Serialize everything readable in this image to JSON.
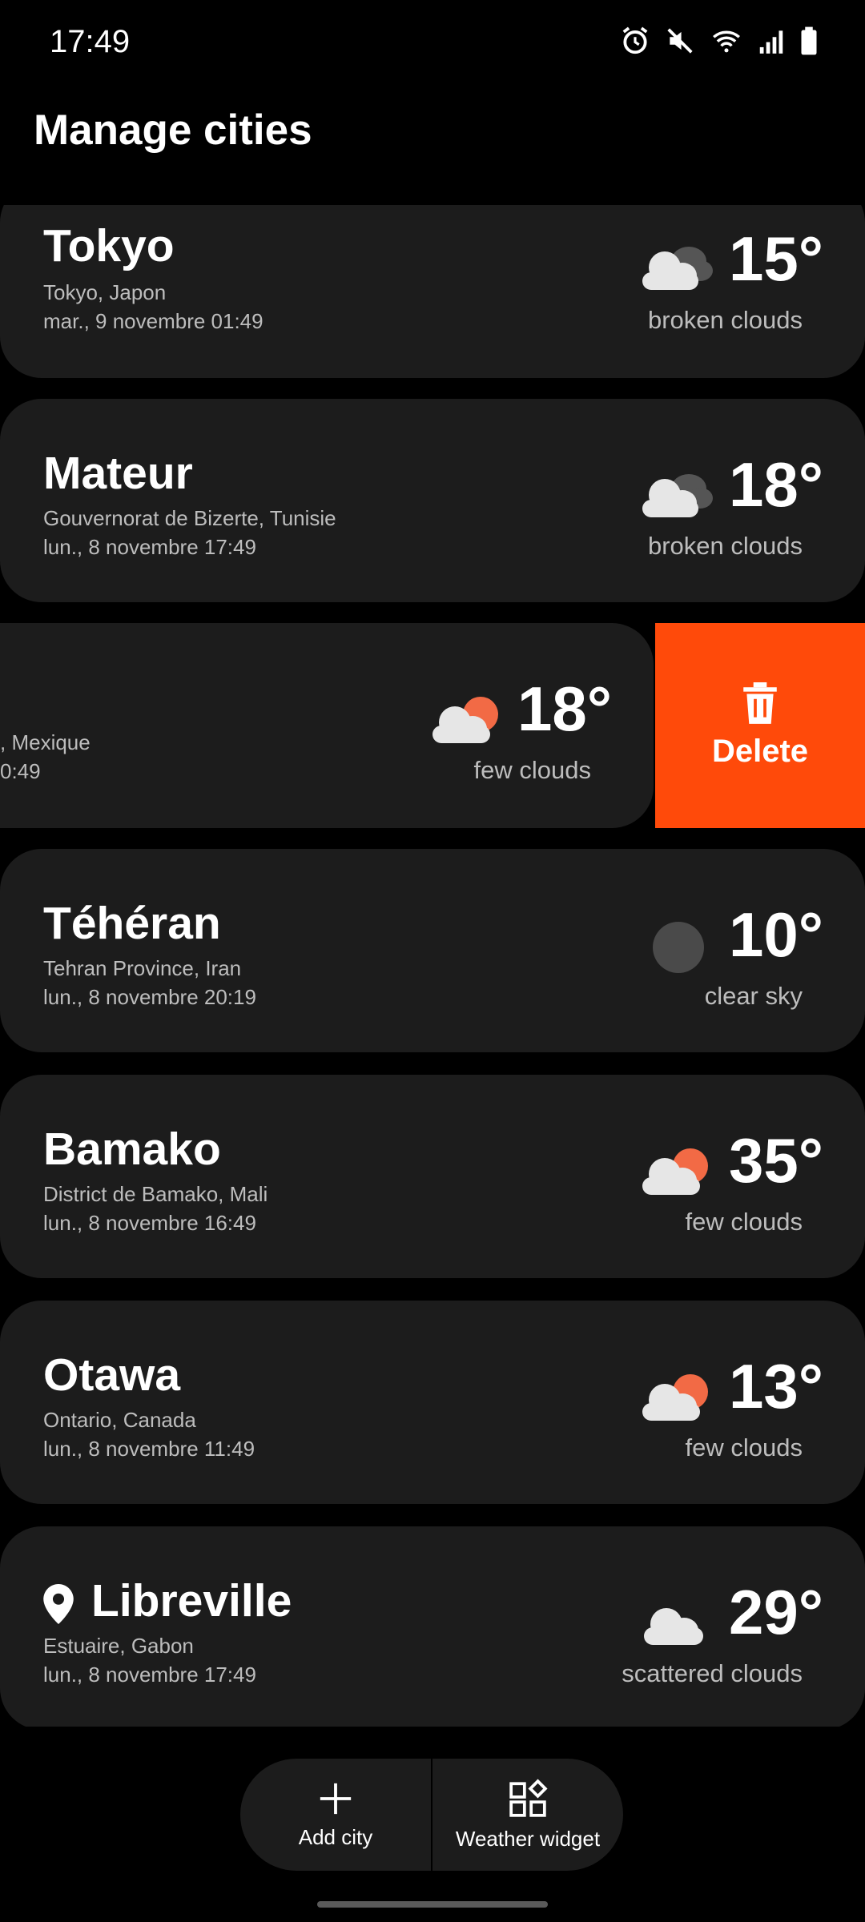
{
  "status_bar": {
    "time": "17:49",
    "icons": [
      "alarm-icon",
      "mute-icon",
      "wifi-icon",
      "signal-icon",
      "battery-icon"
    ]
  },
  "header": {
    "title": "Manage cities"
  },
  "cities": [
    {
      "name": "Tokyo",
      "region": "Tokyo, Japon",
      "datetime": "mar., 9 novembre 01:49",
      "temp": "15°",
      "condition": "broken clouds",
      "icon": "broken-clouds-icon"
    },
    {
      "name": "Mateur",
      "region": "Gouvernorat de Bizerte, Tunisie",
      "datetime": "lun., 8 novembre 17:49",
      "temp": "18°",
      "condition": "broken clouds",
      "icon": "broken-clouds-icon"
    },
    {
      "name": "",
      "region": ", Mexique",
      "datetime": "0:49",
      "temp": "18°",
      "condition": "few clouds",
      "icon": "few-clouds-icon",
      "swiped": true
    },
    {
      "name": "Téhéran",
      "region": "Tehran Province, Iran",
      "datetime": "lun., 8 novembre 20:19",
      "temp": "10°",
      "condition": "clear sky",
      "icon": "clear-night-icon"
    },
    {
      "name": "Bamako",
      "region": "District de Bamako, Mali",
      "datetime": "lun., 8 novembre 16:49",
      "temp": "35°",
      "condition": "few clouds",
      "icon": "few-clouds-icon"
    },
    {
      "name": "Otawa",
      "region": "Ontario, Canada",
      "datetime": "lun., 8 novembre 11:49",
      "temp": "13°",
      "condition": "few clouds",
      "icon": "few-clouds-icon"
    },
    {
      "name": "Libreville",
      "region": "Estuaire, Gabon",
      "datetime": "lun., 8 novembre 17:49",
      "temp": "29°",
      "condition": "scattered clouds",
      "icon": "scattered-clouds-icon",
      "current_location": true
    }
  ],
  "swipe_action": {
    "label": "Delete",
    "icon": "trash-icon",
    "color": "#ff4a0a"
  },
  "bottom_bar": {
    "add_city_label": "Add city",
    "widget_label": "Weather widget"
  },
  "colors": {
    "background": "#000000",
    "card": "#1c1c1c",
    "secondary_text": "#bdbdbd",
    "sun": "#f26a45"
  }
}
